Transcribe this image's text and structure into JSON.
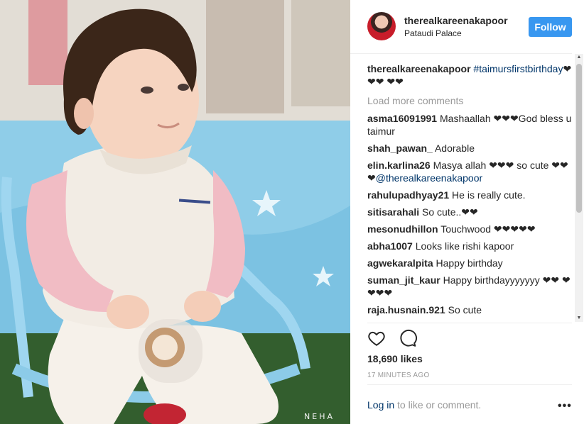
{
  "post": {
    "watermark": "NEHA"
  },
  "header": {
    "username": "therealkareenakapoor",
    "location": "Pataudi Palace",
    "follow_label": "Follow"
  },
  "caption": {
    "username": "therealkareenakapoor",
    "hashtag": "#taimursfirstbirthday",
    "emoji": "❤❤❤ ❤❤"
  },
  "load_more": "Load more comments",
  "comments": [
    {
      "user": "asma16091991",
      "text": "Mashaallah ❤❤❤God bless u taimur"
    },
    {
      "user": "shah_pawan_",
      "text": "Adorable"
    },
    {
      "user": "elin.karlina26",
      "text": "Masya allah ❤❤❤ so cute ❤❤ ❤",
      "mention": "@therealkareenakapoor"
    },
    {
      "user": "rahulupadhyay21",
      "text": "He is really cute."
    },
    {
      "user": "sitisarahali",
      "text": "So cute..❤❤"
    },
    {
      "user": "mesonudhillon",
      "text": "Touchwood ❤❤❤❤❤"
    },
    {
      "user": "abha1007",
      "text": "Looks like rishi kapoor"
    },
    {
      "user": "agwekaralpita",
      "text": "Happy birthday"
    },
    {
      "user": "suman_jit_kaur",
      "text": "Happy birthdayyyyyyy ❤❤ ❤❤❤❤"
    },
    {
      "user": "raja.husnain.921",
      "text": "So cute"
    }
  ],
  "likes": "18,690 likes",
  "timestamp": "17 MINUTES AGO",
  "footer": {
    "login_link": "Log in",
    "login_rest": " to like or comment.",
    "more": "•••"
  },
  "icons": {
    "like": "heart-icon",
    "comment": "comment-icon",
    "more": "more-options-icon"
  },
  "colors": {
    "follow_bg": "#3897f0",
    "link": "#003569",
    "muted": "#999999"
  }
}
